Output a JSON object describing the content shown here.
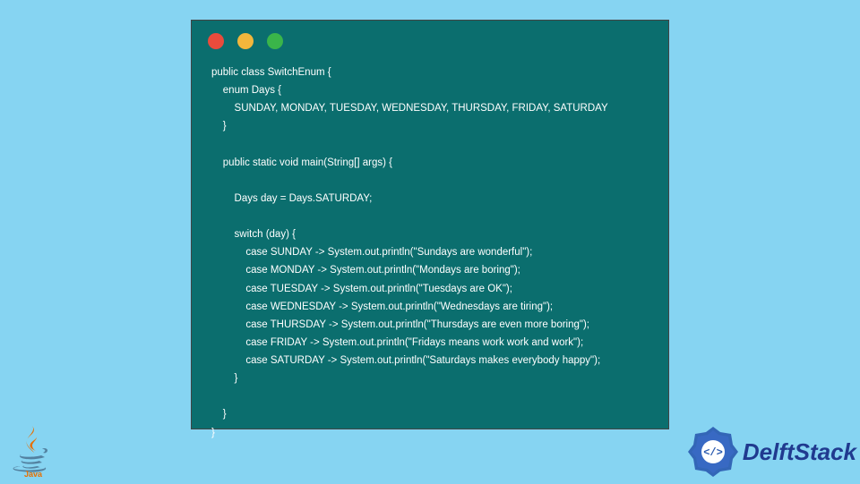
{
  "colors": {
    "bg": "#86d4f2",
    "panel": "#0b6e6e",
    "dot_red": "#e94b3c",
    "dot_yellow": "#f2b63c",
    "dot_green": "#3ab54a",
    "delft_blue": "#203a8f",
    "java_red": "#e76f00"
  },
  "code": {
    "lines": [
      "public class SwitchEnum {",
      "    enum Days {",
      "        SUNDAY, MONDAY, TUESDAY, WEDNESDAY, THURSDAY, FRIDAY, SATURDAY",
      "    }",
      "",
      "    public static void main(String[] args) {",
      "",
      "        Days day = Days.SATURDAY;",
      "",
      "        switch (day) {",
      "            case SUNDAY -> System.out.println(\"Sundays are wonderful\");",
      "            case MONDAY -> System.out.println(\"Mondays are boring\");",
      "            case TUESDAY -> System.out.println(\"Tuesdays are OK\");",
      "            case WEDNESDAY -> System.out.println(\"Wednesdays are tiring\");",
      "            case THURSDAY -> System.out.println(\"Thursdays are even more boring\");",
      "            case FRIDAY -> System.out.println(\"Fridays means work work and work\");",
      "            case SATURDAY -> System.out.println(\"Saturdays makes everybody happy\");",
      "        }",
      "",
      "    }",
      "}"
    ]
  },
  "java_logo": {
    "label": "Java"
  },
  "delftstack": {
    "label": "DelftStack"
  }
}
